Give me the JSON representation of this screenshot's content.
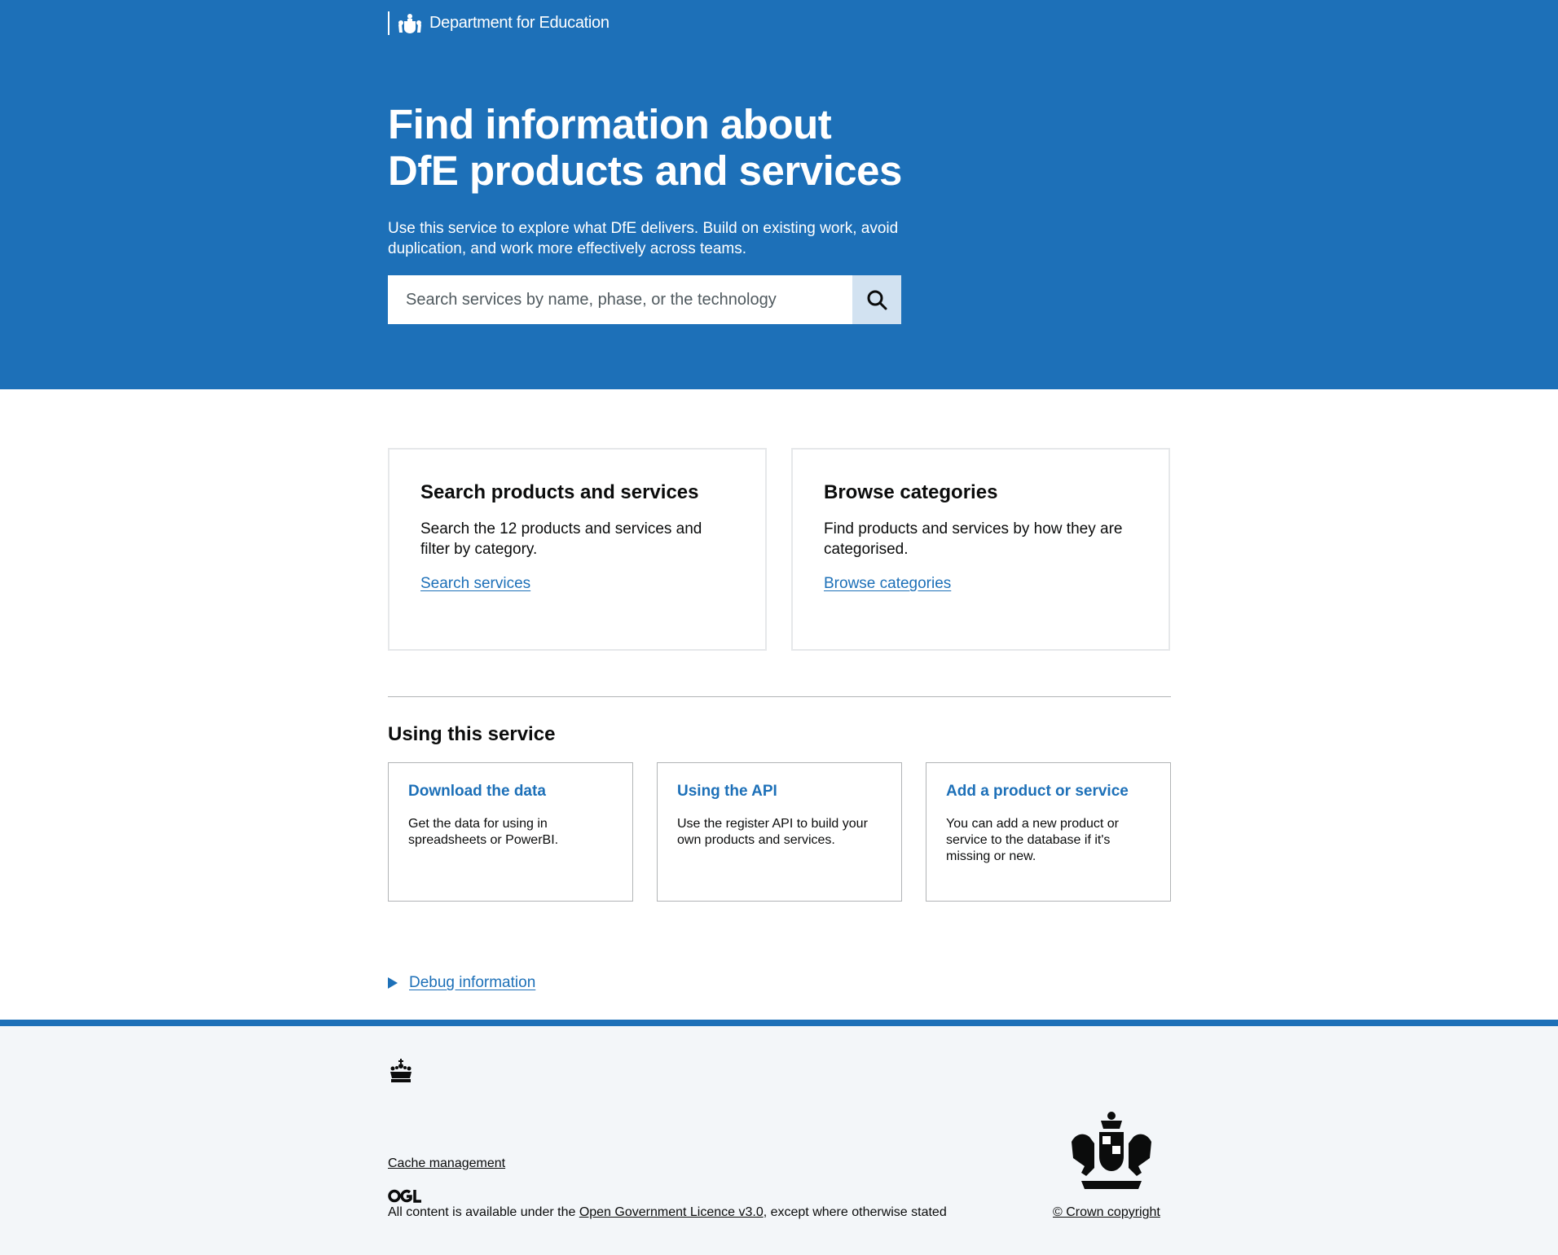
{
  "header": {
    "organisation": "Department for Education"
  },
  "hero": {
    "title": "Find information about DfE products and services",
    "lead": "Use this service to explore what DfE delivers. Build on existing work, avoid duplication, and work more effectively across teams.",
    "search_placeholder": "Search services by name, phase, or the technology",
    "search_icon": "search-icon"
  },
  "cards": [
    {
      "title": "Search products and services",
      "description": "Search the 12 products and services and filter by category.",
      "link": "Search services"
    },
    {
      "title": "Browse categories",
      "description": "Find products and services by how they are categorised.",
      "link": "Browse categories"
    }
  ],
  "using_service": {
    "title": "Using this service",
    "tiles": [
      {
        "title": "Download the data",
        "description": "Get the data for using in spreadsheets or PowerBI."
      },
      {
        "title": "Using the API",
        "description": "Use the register API to build your own products and services."
      },
      {
        "title": "Add a product or service",
        "description": "You can add a new product or service to the database if it's missing or new."
      }
    ]
  },
  "debug": {
    "label": "Debug information"
  },
  "footer": {
    "cache_link": "Cache management",
    "licence_prefix": "All content is available under the ",
    "licence_link": "Open Government Licence v3.0",
    "licence_suffix": ", except where otherwise stated",
    "copyright": "© Crown copyright"
  },
  "colors": {
    "brand_blue": "#1d70b8",
    "footer_bg": "#f3f6f9",
    "search_button_bg": "#d2e2f1"
  }
}
